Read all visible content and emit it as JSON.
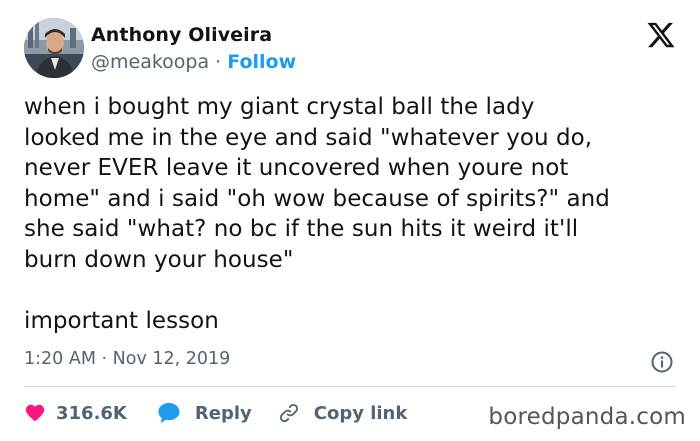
{
  "header": {
    "display_name": "Anthony Oliveira",
    "handle": "@meakoopa",
    "separator": " · ",
    "follow_label": "Follow",
    "platform_icon": "x-logo-icon"
  },
  "tweet": {
    "text": "when i bought my giant crystal ball the lady\nlooked me in the eye and said \"whatever you do,\nnever EVER leave it uncovered when youre not\nhome\" and i said \"oh wow because of spirits?\" and\nshe said \"what? no bc if the sun hits it weird it'll\nburn down your house\"\n\nimportant lesson",
    "time": "1:20 AM",
    "meta_separator": " · ",
    "date": "Nov 12, 2019"
  },
  "actions": {
    "like_count": "316.6K",
    "reply_label": "Reply",
    "copy_link_label": "Copy link"
  },
  "watermark": "boredpanda.com",
  "colors": {
    "text": "#0f1419",
    "secondary": "#536471",
    "accent_blue": "#1d9bf0",
    "like_red": "#f91880",
    "divider": "#cfd9de"
  }
}
